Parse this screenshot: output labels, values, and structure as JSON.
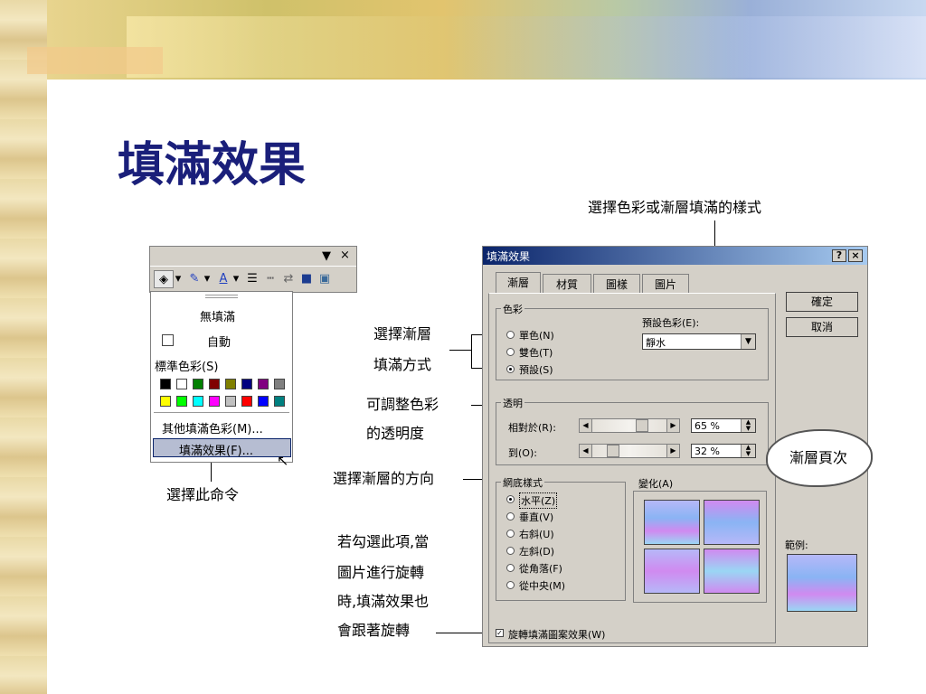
{
  "title": "填滿效果",
  "captions": {
    "select_style": "選擇色彩或漸層填滿的樣式",
    "select_gradient_l1": "選擇漸層",
    "select_gradient_l2": "填滿方式",
    "adjust_l1": "可調整色彩",
    "adjust_l2": "的透明度",
    "direction": "選擇漸層的方向",
    "rotate_l1": "若勾選此項,當",
    "rotate_l2": "圖片進行旋轉",
    "rotate_l3": "時,填滿效果也",
    "rotate_l4": "會跟著旋轉",
    "choose_cmd": "選擇此命令",
    "cloud": "漸層頁次"
  },
  "menu": {
    "no_fill": "無填滿",
    "auto": "自動",
    "std_colors": "標準色彩(S)",
    "other_colors": "其他填滿色彩(M)...",
    "fill_effects": "填滿效果(F)..."
  },
  "swatches_row1": [
    "#000000",
    "#ffffff",
    "#008000",
    "#800000",
    "#808000",
    "#000080",
    "#800080",
    "#808080"
  ],
  "swatches_row2": [
    "#ffff00",
    "#00ff00",
    "#00ffff",
    "#ff00ff",
    "#c0c0c0",
    "#ff0000",
    "#0000ff",
    "#008080"
  ],
  "dialog": {
    "title": "填滿效果",
    "help": "?",
    "close": "×",
    "tabs": [
      "漸層",
      "材質",
      "圖樣",
      "圖片"
    ],
    "ok": "確定",
    "cancel": "取消",
    "color_group": "色彩",
    "preset_colors_label": "預設色彩(E):",
    "preset_value": "靜水",
    "radio_one": "單色(N)",
    "radio_two": "雙色(T)",
    "radio_preset": "預設(S)",
    "transparency_group": "透明",
    "from_label": "相對於(R):",
    "from_value": "65 %",
    "to_label": "到(O):",
    "to_value": "32 %",
    "shading_group": "網底樣式",
    "shading": [
      "水平(Z)",
      "垂直(V)",
      "右斜(U)",
      "左斜(D)",
      "從角落(F)",
      "從中央(M)"
    ],
    "variants_label": "變化(A)",
    "sample_label": "範例:",
    "rotate_check": "旋轉填滿圖案效果(W)"
  }
}
